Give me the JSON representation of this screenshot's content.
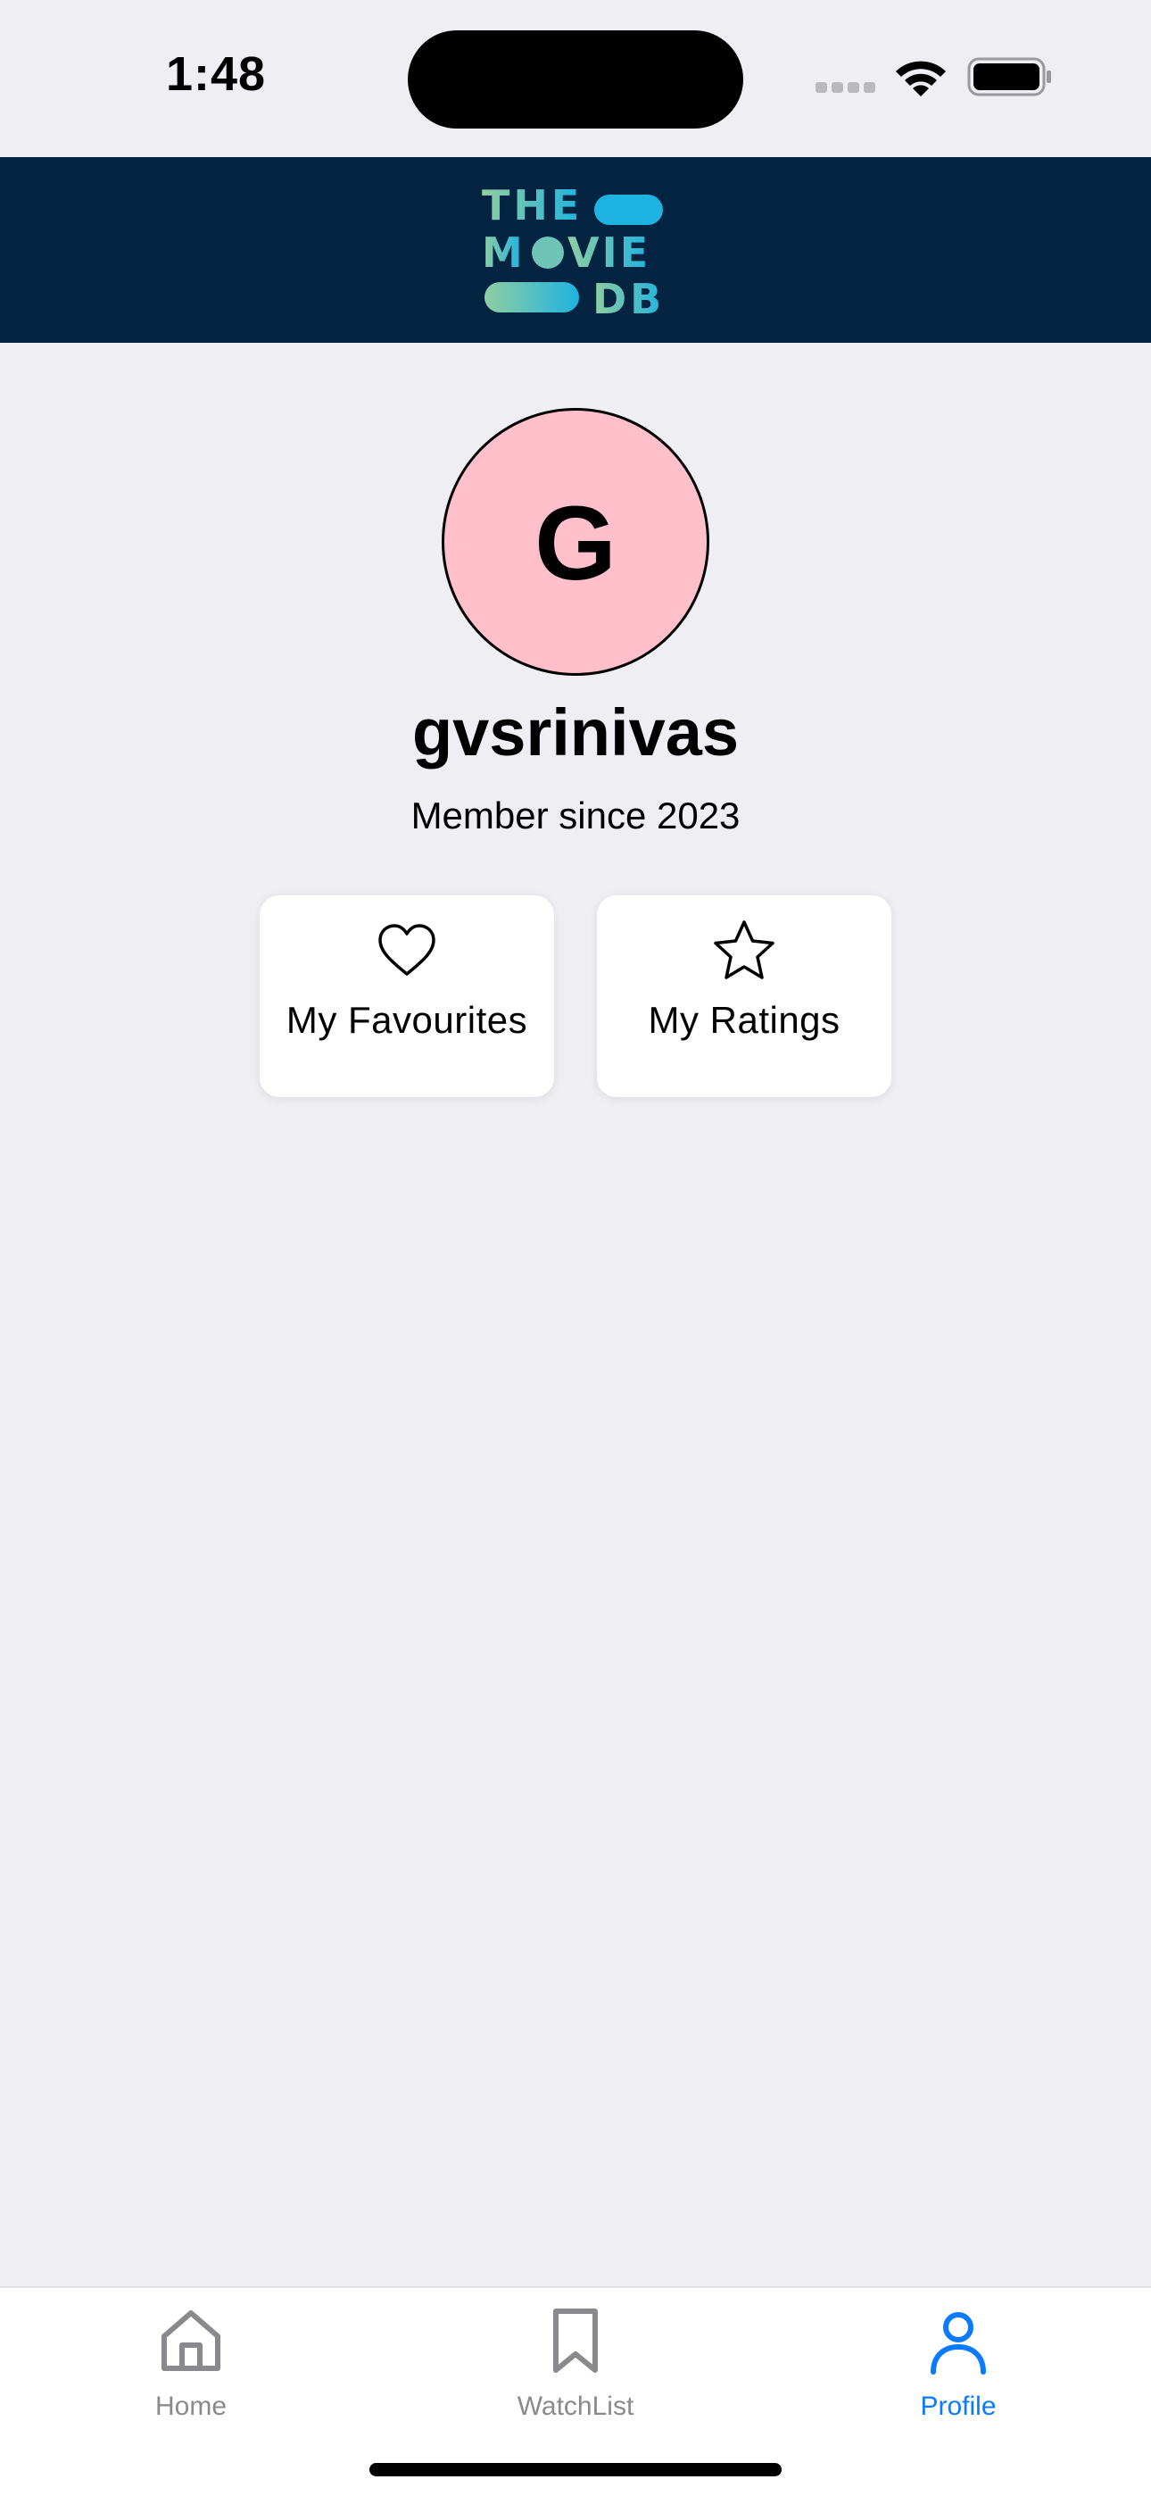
{
  "status_bar": {
    "time": "1:48"
  },
  "header": {
    "logo_line1": "THE",
    "logo_line2a": "M",
    "logo_line2b": "VIE",
    "logo_line3": "DB"
  },
  "profile": {
    "initial": "G",
    "username": "gvsrinivas",
    "member_since": "Member since 2023",
    "avatar_color": "#ffc0cb"
  },
  "cards": {
    "favourites": {
      "label": "My Favourites",
      "icon": "heart-icon"
    },
    "ratings": {
      "label": "My Ratings",
      "icon": "star-icon"
    }
  },
  "tabs": [
    {
      "label": "Home",
      "icon": "home-icon",
      "active": false
    },
    {
      "label": "WatchList",
      "icon": "bookmark-icon",
      "active": false
    },
    {
      "label": "Profile",
      "icon": "person-icon",
      "active": true
    }
  ],
  "colors": {
    "header_bg": "#042442",
    "accent": "#0a7aff",
    "background": "#eeeef3"
  }
}
